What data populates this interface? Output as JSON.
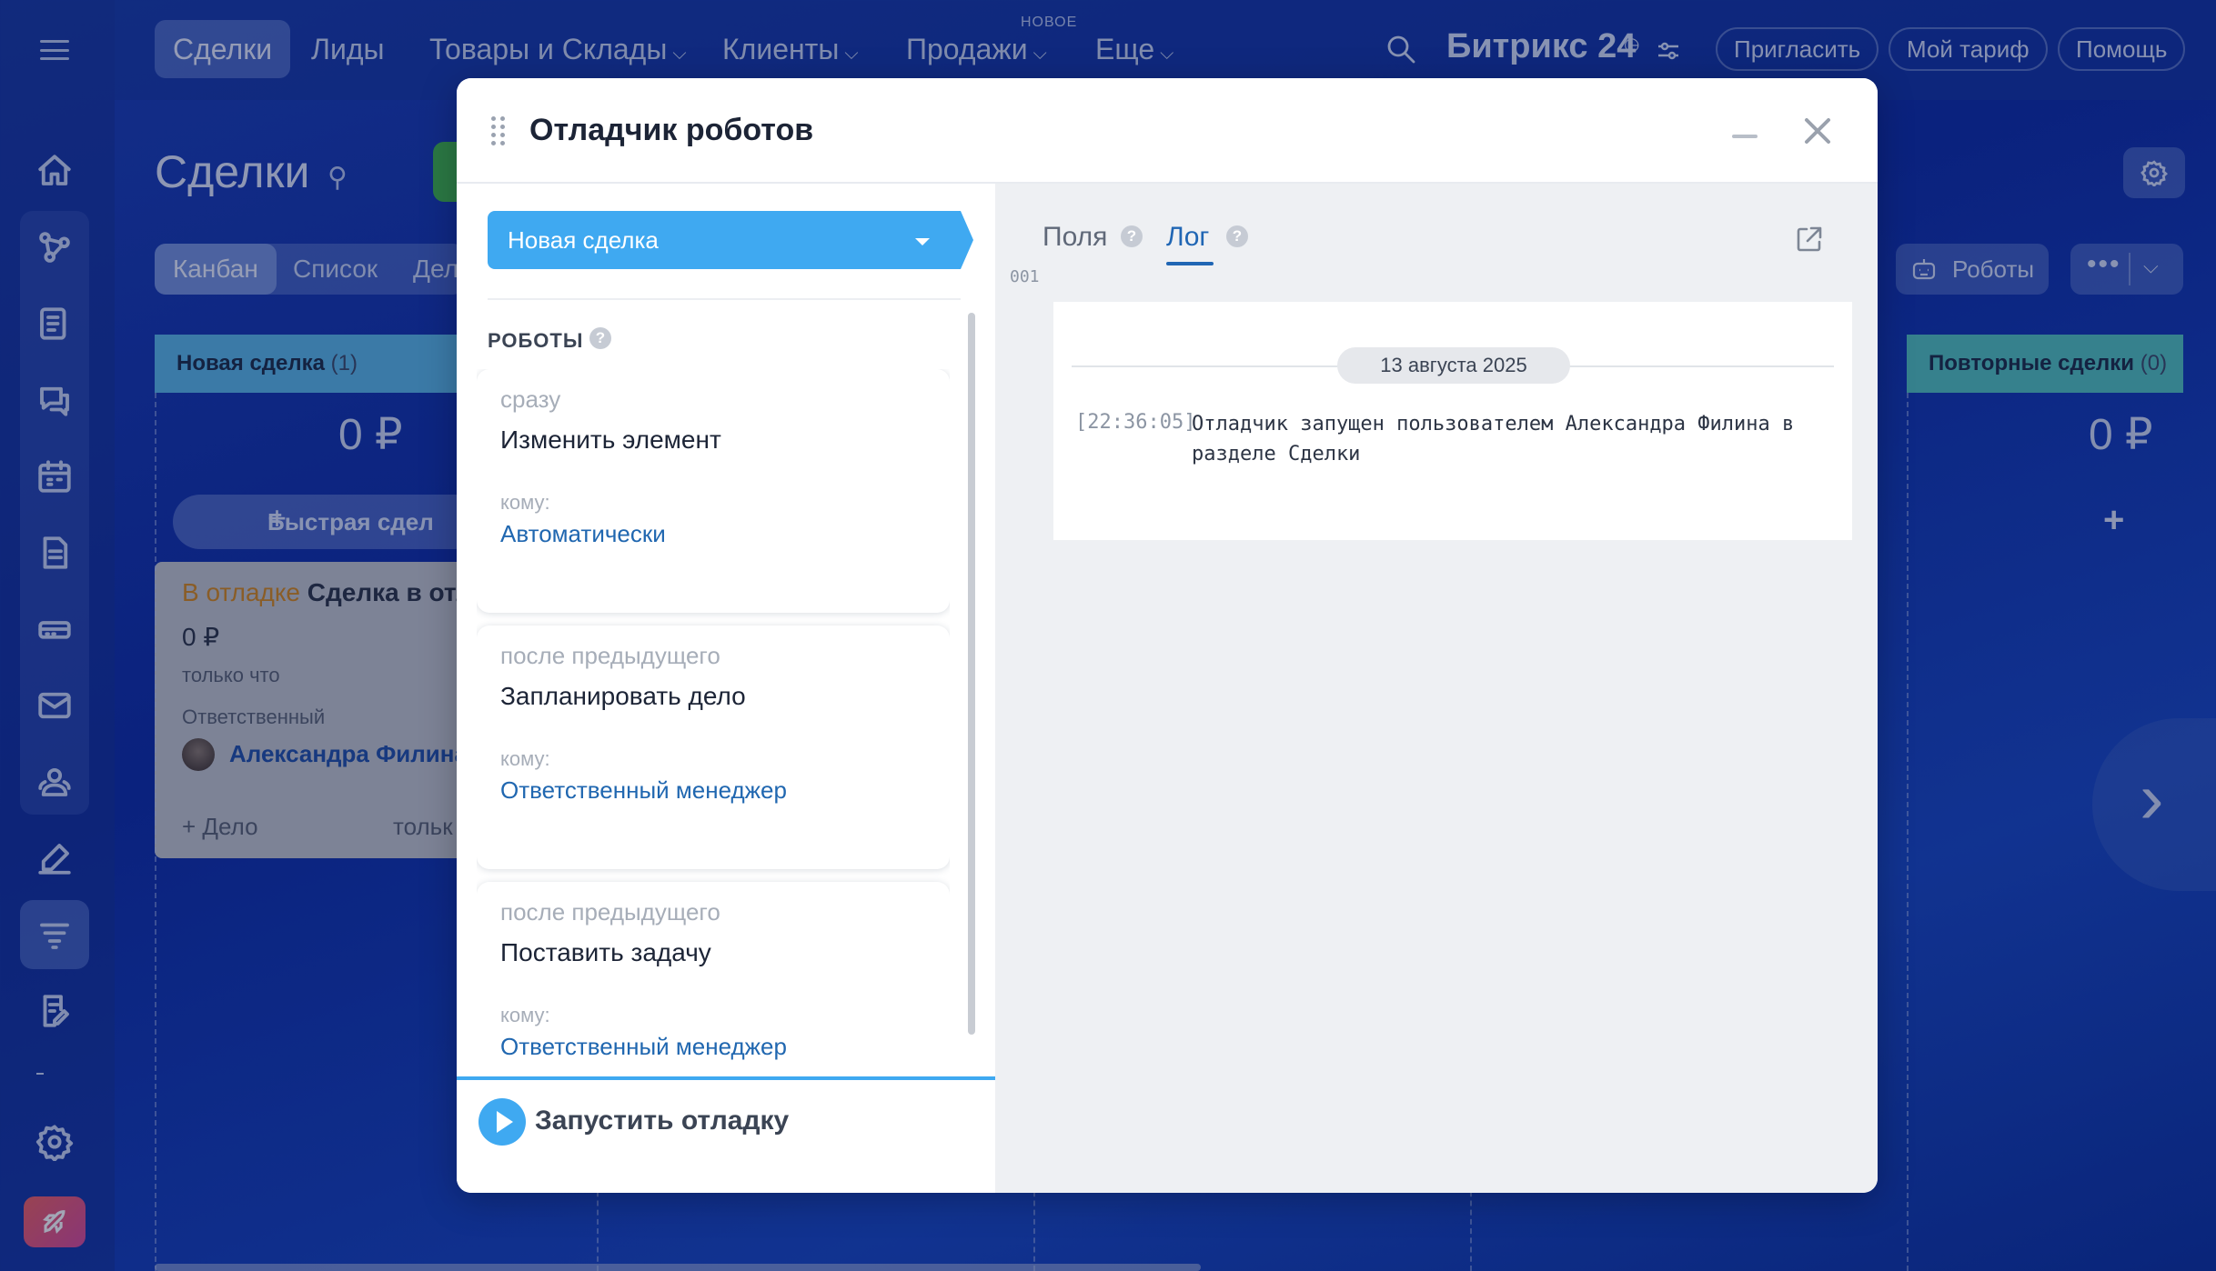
{
  "topnav": {
    "items": [
      {
        "label": "Сделки"
      },
      {
        "label": "Лиды"
      },
      {
        "label": "Товары и Склады"
      },
      {
        "label": "Клиенты"
      },
      {
        "label": "Продажи"
      },
      {
        "label": "Еще"
      }
    ],
    "new_badge": "НОВОЕ",
    "brand": "Битрикс 24",
    "invite": "Пригласить",
    "tariff": "Мой тариф",
    "help": "Помощь"
  },
  "page": {
    "title": "Сделки",
    "view_tabs": [
      "Канбан",
      "Список",
      "Дел"
    ],
    "robots_button": "Роботы",
    "columns": [
      {
        "title": "Новая сделка",
        "count": "(1)",
        "sum": "0 ₽"
      },
      {
        "title": "Повторные сделки",
        "count": "(0)",
        "sum": "0 ₽"
      }
    ],
    "quick_deal": "Быстрая сдел",
    "deal_card": {
      "stage_label": "В отладке",
      "title": "Сделка в отл",
      "amount": "0 ₽",
      "when": "только что",
      "responsible_label": "Ответственный",
      "responsible_name": "Александра Филина",
      "add_activity": "+ Дело",
      "activity_when": "тольк"
    }
  },
  "modal": {
    "title": "Отладчик роботов",
    "stage": "Новая сделка",
    "robots_section": "РОБОТЫ",
    "robots": [
      {
        "when": "сразу",
        "name": "Изменить элемент",
        "to_label": "кому:",
        "to": "Автоматически"
      },
      {
        "when": "после предыдущего",
        "name": "Запланировать дело",
        "to_label": "кому:",
        "to": "Ответственный менеджер"
      },
      {
        "when": "после предыдущего",
        "name": "Поставить задачу",
        "to_label": "кому:",
        "to": "Ответственный менеджер"
      }
    ],
    "run_button": "Запустить отладку",
    "tabs": {
      "fields": "Поля",
      "log": "Лог",
      "active": "log"
    },
    "log": {
      "date": "13 августа 2025",
      "entries": [
        {
          "num": "001",
          "time": "[22:36:05]",
          "text": "Отладчик запущен пользователем Александра Филина в разделе Сделки"
        }
      ]
    }
  }
}
